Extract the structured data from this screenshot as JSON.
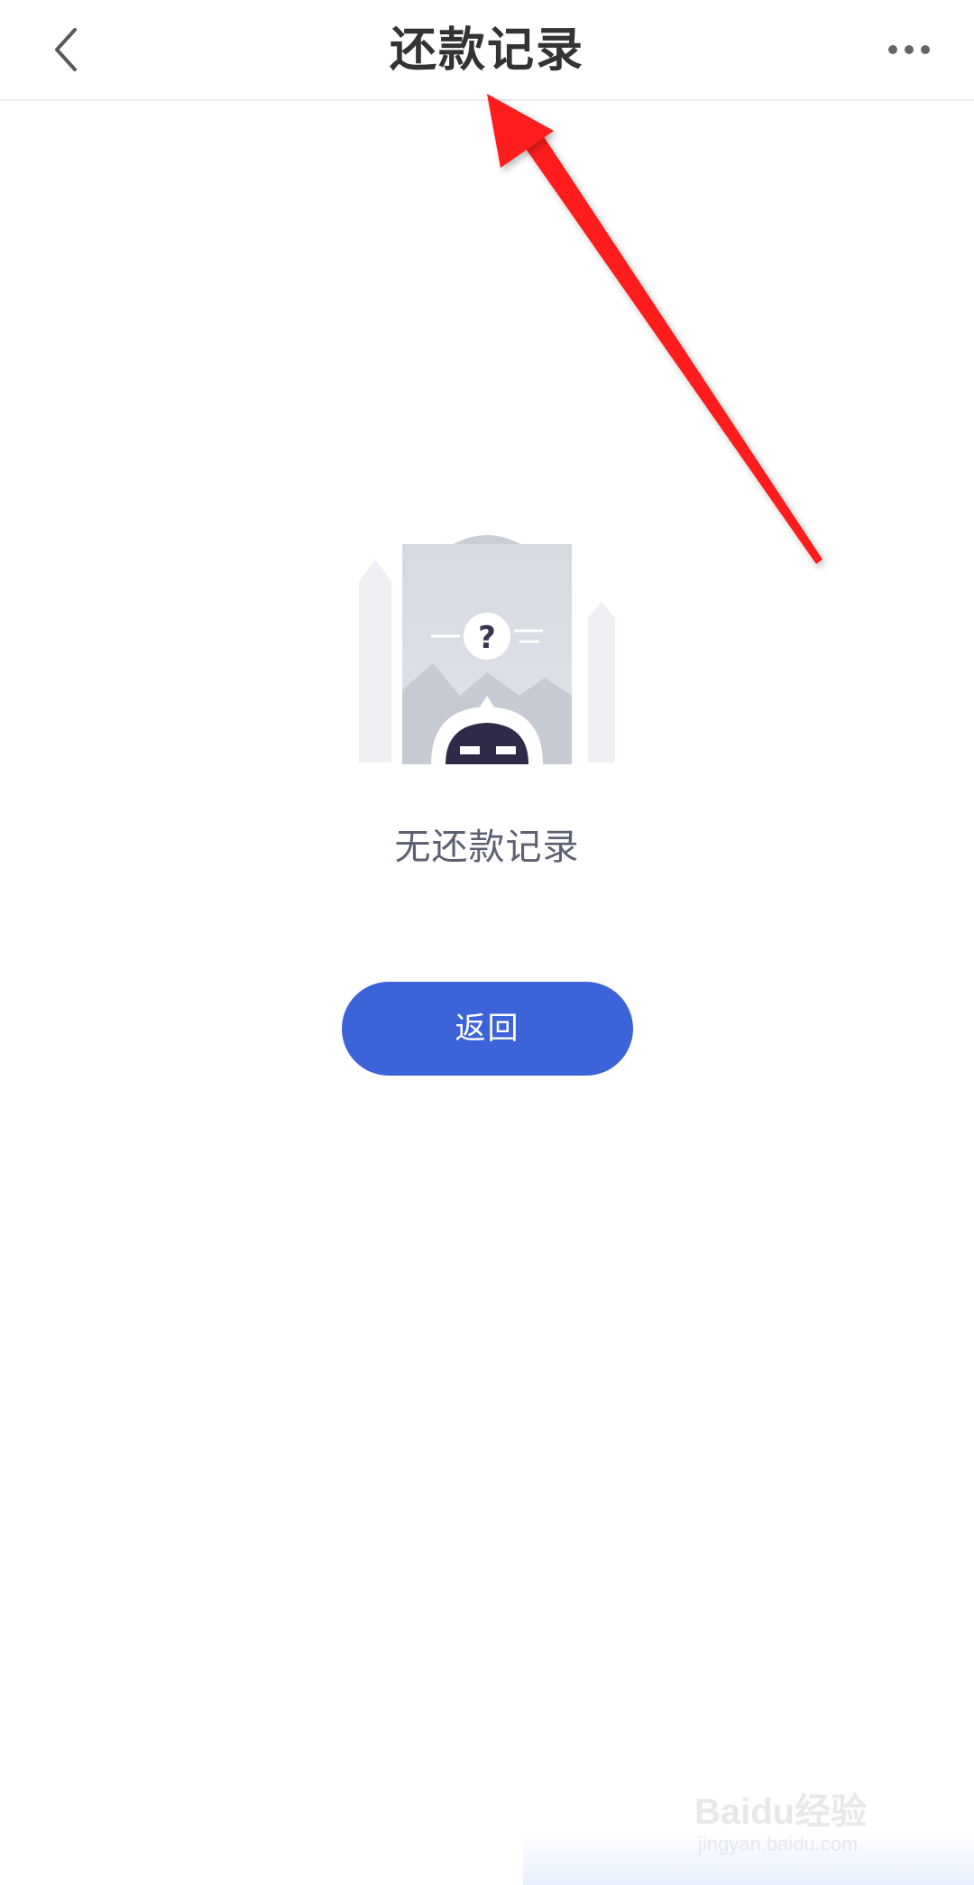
{
  "header": {
    "title": "还款记录",
    "back_icon": "chevron-left-icon",
    "more_icon": "more-dots-icon"
  },
  "empty_state": {
    "illustration_icon": "empty-clipboard-question-icon",
    "message": "无还款记录"
  },
  "actions": {
    "back_label": "返回"
  },
  "watermark": {
    "brand": "Baidu经验",
    "url": "jingyan.baidu.com"
  },
  "colors": {
    "accent": "#3d63d9",
    "annotation_arrow": "#ff1a1a",
    "title_text": "#333333",
    "message_text": "#5c6072"
  }
}
